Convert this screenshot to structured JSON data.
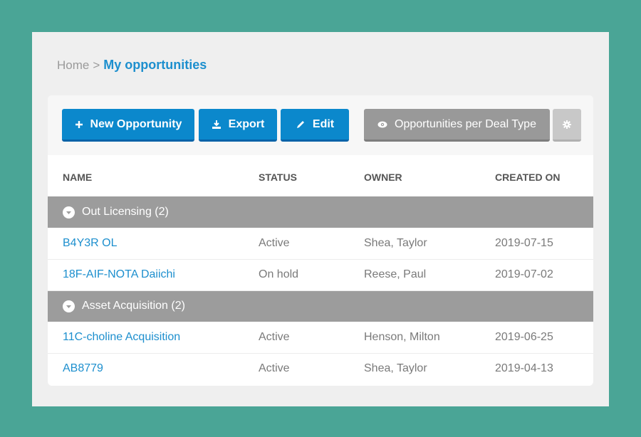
{
  "breadcrumb": {
    "home": "Home",
    "separator": ">",
    "current": "My opportunities"
  },
  "toolbar": {
    "new_label": "New Opportunity",
    "export_label": "Export",
    "edit_label": "Edit",
    "deal_type_label": "Opportunities per Deal Type",
    "icons": {
      "new": "plus-icon",
      "export": "download-icon",
      "edit": "pencil-icon",
      "deal_type": "eye-icon",
      "settings": "gear-icon"
    }
  },
  "table": {
    "columns": [
      "NAME",
      "STATUS",
      "OWNER",
      "CREATED ON"
    ],
    "groups": [
      {
        "label": "Out Licensing (2)",
        "rows": [
          {
            "name": "B4Y3R OL",
            "status": "Active",
            "owner": "Shea, Taylor",
            "created": "2019-07-15"
          },
          {
            "name": "18F-AIF-NOTA Daiichi",
            "status": "On hold",
            "owner": "Reese, Paul",
            "created": "2019-07-02"
          }
        ]
      },
      {
        "label": "Asset Acquisition (2)",
        "rows": [
          {
            "name": "11C-choline Acquisition",
            "status": "Active",
            "owner": "Henson, Milton",
            "created": "2019-06-25"
          },
          {
            "name": "AB8779",
            "status": "Active",
            "owner": "Shea, Taylor",
            "created": "2019-04-13"
          }
        ]
      }
    ]
  },
  "colors": {
    "background": "#4aa596",
    "accent": "#0b88cc",
    "link": "#1d8fce",
    "group_header": "#9c9c9c"
  }
}
